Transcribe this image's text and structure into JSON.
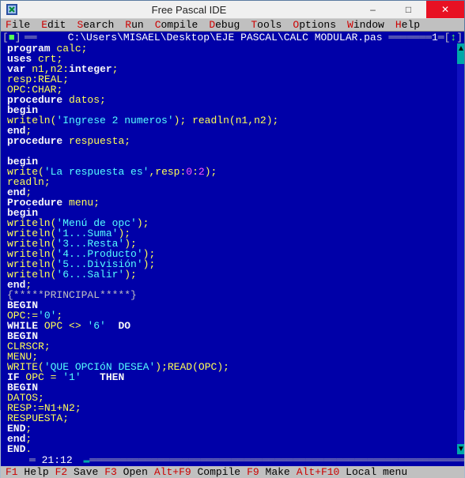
{
  "window": {
    "title": "Free Pascal IDE"
  },
  "menubar": [
    {
      "hot": "F",
      "rest": "ile"
    },
    {
      "hot": "E",
      "rest": "dit"
    },
    {
      "hot": "S",
      "rest": "earch"
    },
    {
      "hot": "R",
      "rest": "un"
    },
    {
      "hot": "C",
      "rest": "ompile"
    },
    {
      "hot": "D",
      "rest": "ebug"
    },
    {
      "hot": "T",
      "rest": "ools"
    },
    {
      "hot": "O",
      "rest": "ptions"
    },
    {
      "hot": "W",
      "rest": "indow"
    },
    {
      "hot": "H",
      "rest": "elp"
    }
  ],
  "frame": {
    "path": " C:\\Users\\MISAEL\\Desktop\\EJE PASCAL\\CALC MODULAR.pas ",
    "right_marker": "1=[↕]",
    "left_marker_open": "[",
    "left_marker_close": "]",
    "left_box": "■"
  },
  "cursor": {
    "line": "21",
    "col": "12",
    "modified_marker": "▬"
  },
  "statusbar": [
    {
      "key": "F1",
      "label": " Help"
    },
    {
      "key": "F2",
      "label": " Save"
    },
    {
      "key": "F3",
      "label": " Open"
    },
    {
      "key": "Alt+F9",
      "label": " Compile"
    },
    {
      "key": "F9",
      "label": " Make"
    },
    {
      "key": "Alt+F10",
      "label": " Local menu"
    }
  ],
  "code": [
    [
      [
        "kw",
        "program"
      ],
      [
        "sym",
        " "
      ],
      [
        "id",
        "calc"
      ],
      [
        "sym",
        ";"
      ]
    ],
    [
      [
        "kw",
        "uses"
      ],
      [
        "sym",
        " "
      ],
      [
        "id",
        "crt"
      ],
      [
        "sym",
        ";"
      ]
    ],
    [
      [
        "kw",
        "var"
      ],
      [
        "sym",
        " "
      ],
      [
        "id",
        "n1"
      ],
      [
        "sym",
        ","
      ],
      [
        "id",
        "n2"
      ],
      [
        "sym",
        ":"
      ],
      [
        "kw",
        "integer"
      ],
      [
        "sym",
        ";"
      ]
    ],
    [
      [
        "id",
        "resp"
      ],
      [
        "sym",
        ":"
      ],
      [
        "id",
        "REAL"
      ],
      [
        "sym",
        ";"
      ]
    ],
    [
      [
        "id",
        "OPC"
      ],
      [
        "sym",
        ":"
      ],
      [
        "id",
        "CHAR"
      ],
      [
        "sym",
        ";"
      ]
    ],
    [
      [
        "kw",
        "procedure"
      ],
      [
        "sym",
        " "
      ],
      [
        "id",
        "datos"
      ],
      [
        "sym",
        ";"
      ]
    ],
    [
      [
        "kw",
        "begin"
      ]
    ],
    [
      [
        "id",
        "writeln"
      ],
      [
        "sym",
        "("
      ],
      [
        "str",
        "'Ingrese 2 numeros'"
      ],
      [
        "sym",
        "); "
      ],
      [
        "id",
        "readln"
      ],
      [
        "sym",
        "("
      ],
      [
        "id",
        "n1"
      ],
      [
        "sym",
        ","
      ],
      [
        "id",
        "n2"
      ],
      [
        "sym",
        ");"
      ]
    ],
    [
      [
        "kw",
        "end"
      ],
      [
        "sym",
        ";"
      ]
    ],
    [
      [
        "kw",
        "procedure"
      ],
      [
        "sym",
        " "
      ],
      [
        "id",
        "respuesta"
      ],
      [
        "sym",
        ";"
      ]
    ],
    [],
    [
      [
        "kw",
        "begin"
      ]
    ],
    [
      [
        "id",
        "write"
      ],
      [
        "sym",
        "("
      ],
      [
        "str",
        "'La respuesta es'"
      ],
      [
        "sym",
        ","
      ],
      [
        "id",
        "resp"
      ],
      [
        "sym",
        ":"
      ],
      [
        "num",
        "0"
      ],
      [
        "sym",
        ":"
      ],
      [
        "num",
        "2"
      ],
      [
        "sym",
        ");"
      ]
    ],
    [
      [
        "id",
        "readln"
      ],
      [
        "sym",
        ";"
      ]
    ],
    [
      [
        "kw",
        "end"
      ],
      [
        "sym",
        ";"
      ]
    ],
    [
      [
        "kw",
        "Procedure"
      ],
      [
        "sym",
        " "
      ],
      [
        "id",
        "menu"
      ],
      [
        "sym",
        ";"
      ]
    ],
    [
      [
        "kw",
        "begin"
      ]
    ],
    [
      [
        "id",
        "writeln"
      ],
      [
        "sym",
        "("
      ],
      [
        "str",
        "'Menú de opc'"
      ],
      [
        "sym",
        ");"
      ]
    ],
    [
      [
        "id",
        "writeln"
      ],
      [
        "sym",
        "("
      ],
      [
        "str",
        "'1...Suma'"
      ],
      [
        "sym",
        ");"
      ]
    ],
    [
      [
        "id",
        "writeln"
      ],
      [
        "sym",
        "("
      ],
      [
        "str",
        "'3...Resta'"
      ],
      [
        "sym",
        ");"
      ]
    ],
    [
      [
        "id",
        "writeln"
      ],
      [
        "sym",
        "("
      ],
      [
        "str",
        "'4...Producto'"
      ],
      [
        "sym",
        ");"
      ]
    ],
    [
      [
        "id",
        "writeln"
      ],
      [
        "sym",
        "("
      ],
      [
        "str",
        "'5...División'"
      ],
      [
        "sym",
        ");"
      ]
    ],
    [
      [
        "id",
        "writeln"
      ],
      [
        "sym",
        "("
      ],
      [
        "str",
        "'6...Salir'"
      ],
      [
        "sym",
        ");"
      ]
    ],
    [
      [
        "kw",
        "end"
      ],
      [
        "sym",
        ";"
      ]
    ],
    [
      [
        "com",
        "{*****PRINCIPAL*****}"
      ]
    ],
    [
      [
        "kw",
        "BEGIN"
      ]
    ],
    [
      [
        "id",
        "OPC"
      ],
      [
        "sym",
        ":="
      ],
      [
        "str",
        "'0'"
      ],
      [
        "sym",
        ";"
      ]
    ],
    [
      [
        "kw",
        "WHILE"
      ],
      [
        "sym",
        " "
      ],
      [
        "id",
        "OPC"
      ],
      [
        "sym",
        " <> "
      ],
      [
        "str",
        "'6'"
      ],
      [
        "sym",
        "  "
      ],
      [
        "kw",
        "DO"
      ]
    ],
    [
      [
        "kw",
        "BEGIN"
      ]
    ],
    [
      [
        "id",
        "CLRSCR"
      ],
      [
        "sym",
        ";"
      ]
    ],
    [
      [
        "id",
        "MENU"
      ],
      [
        "sym",
        ";"
      ]
    ],
    [
      [
        "id",
        "WRITE"
      ],
      [
        "sym",
        "("
      ],
      [
        "str",
        "'QUE OPCIóN DESEA'"
      ],
      [
        "sym",
        ");"
      ],
      [
        "id",
        "READ"
      ],
      [
        "sym",
        "("
      ],
      [
        "id",
        "OPC"
      ],
      [
        "sym",
        ");"
      ]
    ],
    [
      [
        "kw",
        "IF"
      ],
      [
        "sym",
        " "
      ],
      [
        "id",
        "OPC"
      ],
      [
        "sym",
        " = "
      ],
      [
        "str",
        "'1'"
      ],
      [
        "sym",
        "   "
      ],
      [
        "kw",
        "THEN"
      ]
    ],
    [
      [
        "kw",
        "BEGIN"
      ]
    ],
    [
      [
        "id",
        "DATOS"
      ],
      [
        "sym",
        ";"
      ]
    ],
    [
      [
        "id",
        "RESP"
      ],
      [
        "sym",
        ":="
      ],
      [
        "id",
        "N1"
      ],
      [
        "sym",
        "+"
      ],
      [
        "id",
        "N2"
      ],
      [
        "sym",
        ";"
      ]
    ],
    [
      [
        "id",
        "RESPUESTA"
      ],
      [
        "sym",
        ";"
      ]
    ],
    [
      [
        "kw",
        "END"
      ],
      [
        "sym",
        ";"
      ]
    ],
    [
      [
        "kw",
        "end"
      ],
      [
        "sym",
        ";"
      ]
    ],
    [
      [
        "kw",
        "END"
      ],
      [
        "sym",
        "."
      ]
    ]
  ]
}
